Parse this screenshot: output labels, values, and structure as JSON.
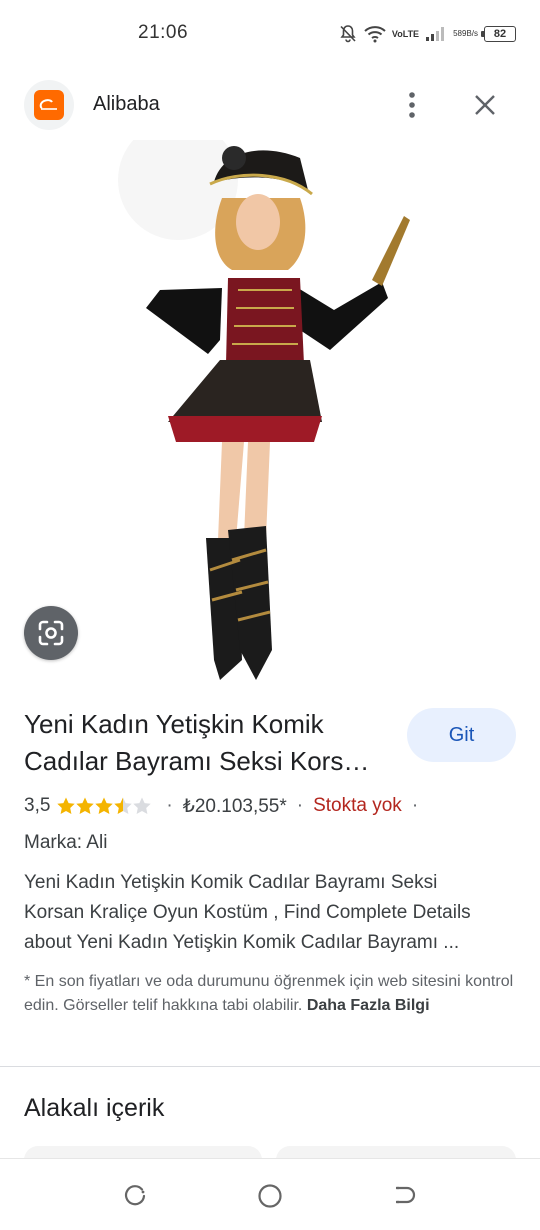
{
  "status_bar": {
    "time": "21:06",
    "volte_top": "Vo",
    "volte_bottom": "LTE",
    "net_speed_value": "589",
    "net_speed_unit": "B/s",
    "battery": "82",
    "icons": [
      "bell-off-icon",
      "wifi-icon",
      "signal-icon",
      "battery-icon"
    ]
  },
  "header": {
    "app_icon": "alibaba-logo-icon",
    "title": "Alibaba",
    "menu_icon": "more-vertical-icon",
    "close_icon": "close-icon"
  },
  "image": {
    "lens_icon": "google-lens-icon"
  },
  "product": {
    "title_line1": "Yeni Kadın Yetişkin Komik",
    "title_line2": "Cadılar Bayramı Seksi Kors…",
    "visit_button": "Git",
    "rating": "3,5",
    "rating_value": 3.5,
    "rating_max": 5,
    "dot1": "·",
    "price": "₺20.103,55*",
    "dot2": "·",
    "stock": "Stokta yok",
    "dot3": "·",
    "brand": "Marka: Ali",
    "description_line1": "Yeni Kadın Yetişkin Komik Cadılar Bayramı Seksi",
    "description_line2": "Korsan Kraliçe Oyun Kostüm , Find Complete Details",
    "description_line3": "about Yeni Kadın Yetişkin Komik Cadılar Bayramı ...",
    "disclaimer": "* En son fiyatları ve oda durumunu öğrenmek için web sitesini kontrol edin. Görseller telif hakkına tabi olabilir.",
    "more_info_link": "Daha Fazla Bilgi"
  },
  "related": {
    "title": "Alakalı içerik"
  },
  "colors": {
    "accent": "#1a56b8",
    "button_bg": "#e8f0fe",
    "stock_out": "#b3261e",
    "star": "#f4b400",
    "logo_orange": "#ff6a00"
  },
  "nav_bar": {
    "icons": [
      "recents-icon",
      "home-icon",
      "back-icon"
    ]
  }
}
